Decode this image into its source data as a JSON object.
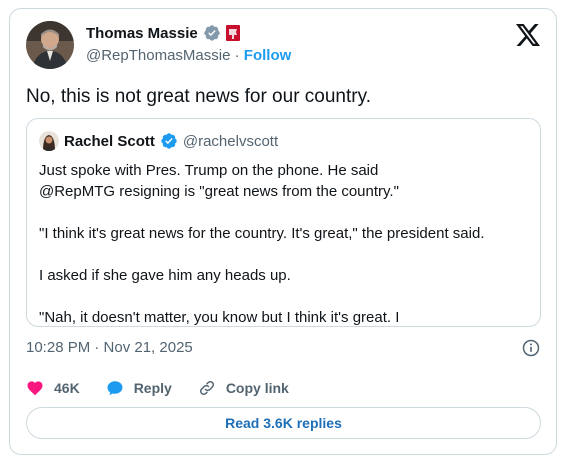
{
  "author": {
    "name": "Thomas Massie",
    "handle": "@RepThomasMassie",
    "separator": "·",
    "follow_label": "Follow"
  },
  "tweet": {
    "text": "No, this is not great news for our country."
  },
  "quoted": {
    "name": "Rachel Scott",
    "handle": "@rachelvscott",
    "lines": [
      "Just spoke with Pres. Trump on the phone. He said",
      "@RepMTG resigning is \"great news from the country.\"",
      "\"I think it's great news for the country. It's great,\" the president said.",
      "I asked if she gave him any heads up.",
      "\"Nah, it doesn't matter, you know but I think it's great. I"
    ]
  },
  "meta": {
    "timestamp": "10:28 PM · Nov 21, 2025"
  },
  "actions": {
    "likes": "46K",
    "reply_label": "Reply",
    "copy_link_label": "Copy link"
  },
  "replies_button_label": "Read 3.6K replies",
  "colors": {
    "accent": "#1d9bf0",
    "like": "#f91880",
    "muted": "#536471",
    "border": "#cfd9de"
  }
}
